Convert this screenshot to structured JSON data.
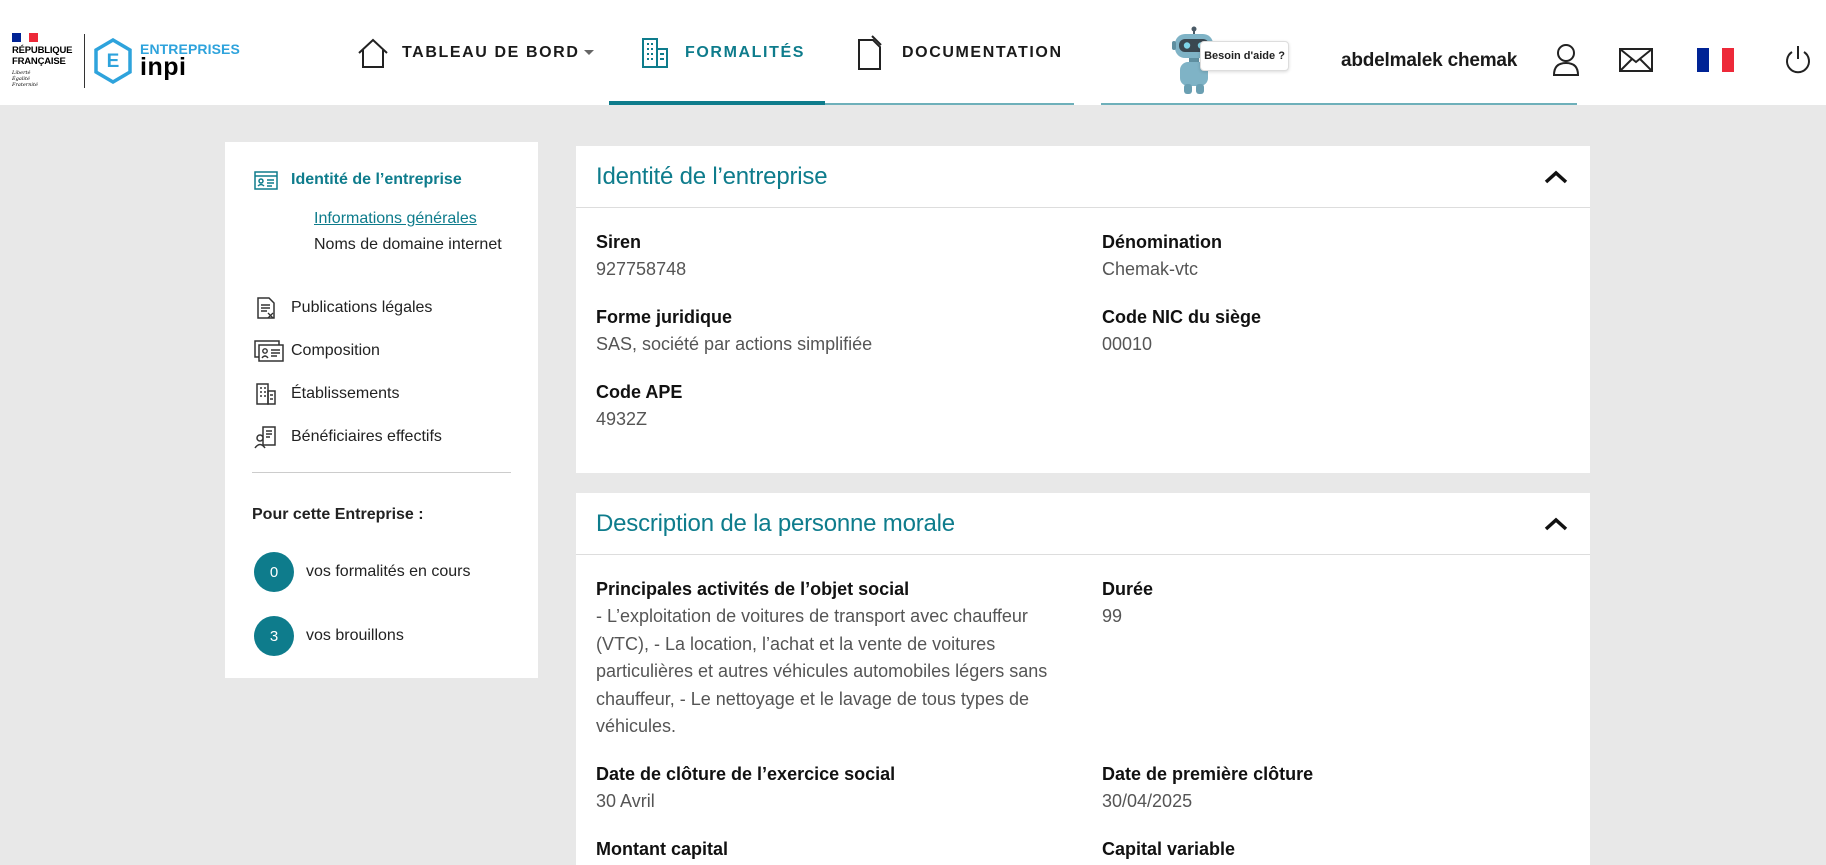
{
  "header": {
    "republic": {
      "line1": "RÉPUBLIQUE",
      "line2": "FRANÇAISE",
      "motto1": "Liberté",
      "motto2": "Égalité",
      "motto3": "Fraternité"
    },
    "brand": {
      "top": "ENTREPRISES",
      "bottom": "inpi",
      "letter": "E"
    },
    "nav": [
      {
        "label": "TABLEAU DE BORD"
      },
      {
        "label": "FORMALITÉS"
      },
      {
        "label": "DOCUMENTATION"
      }
    ],
    "help_label": "Besoin d'aide ?",
    "user_name": "abdelmalek chemak",
    "colors": {
      "accent": "#0e7c8c",
      "brand_blue": "#2ea3dc",
      "fr_blue": "#002395",
      "fr_red": "#ed2939"
    }
  },
  "sidebar": {
    "items": [
      {
        "label": "Identité de l’entreprise",
        "icon": "id-card-icon"
      },
      {
        "label": "Publications légales",
        "icon": "document-icon"
      },
      {
        "label": "Composition",
        "icon": "people-cards-icon"
      },
      {
        "label": "Établissements",
        "icon": "building-doc-icon"
      },
      {
        "label": "Bénéficiaires effectifs",
        "icon": "beneficiary-icon"
      }
    ],
    "subitems": [
      {
        "label": "Informations générales"
      },
      {
        "label": "Noms de domaine internet"
      }
    ],
    "heading": "Pour cette Entreprise :",
    "counts": [
      {
        "value": "0",
        "label": "vos formalités en cours"
      },
      {
        "value": "3",
        "label": "vos brouillons"
      }
    ]
  },
  "identity": {
    "title": "Identité de l’entreprise",
    "siren": {
      "label": "Siren",
      "value": "927758748"
    },
    "denomination": {
      "label": "Dénomination",
      "value": "Chemak-vtc"
    },
    "forme": {
      "label": "Forme juridique",
      "value": "SAS, société par actions simplifiée"
    },
    "nic": {
      "label": "Code NIC du siège",
      "value": "00010"
    },
    "ape": {
      "label": "Code APE",
      "value": "4932Z"
    }
  },
  "description": {
    "title": "Description de la personne morale",
    "activities": {
      "label": "Principales activités de l’objet social",
      "value": "- L’exploitation de voitures de transport avec chauffeur (VTC), - La location, l’achat et la vente de voitures particulières et autres véhicules automobiles légers sans chauffeur, - Le nettoyage et le lavage de tous types de véhicules."
    },
    "duree": {
      "label": "Durée",
      "value": "99"
    },
    "cloture": {
      "label": "Date de clôture de l’exercice social",
      "value": "30 Avril"
    },
    "premiere": {
      "label": "Date de première clôture",
      "value": "30/04/2025"
    },
    "capital": {
      "label": "Montant capital",
      "value": ""
    },
    "variable": {
      "label": "Capital variable",
      "value": ""
    }
  }
}
